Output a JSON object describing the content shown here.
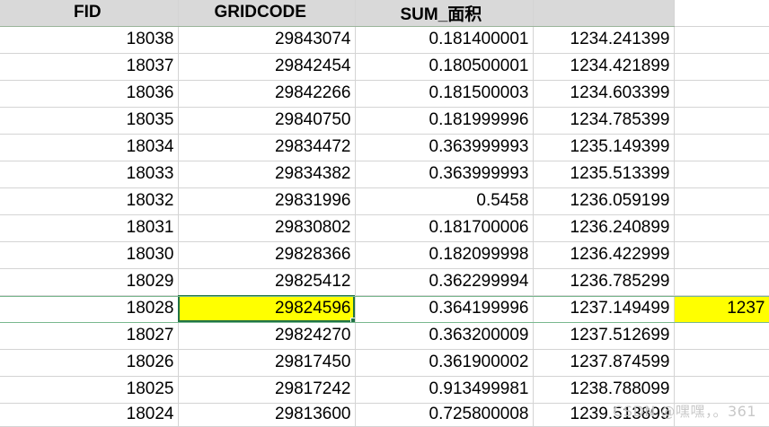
{
  "headers": [
    "FID",
    "GRIDCODE",
    "SUM_面积",
    "",
    ""
  ],
  "rows": [
    [
      "18038",
      "29843074",
      "0.181400001",
      "1234.241399",
      ""
    ],
    [
      "18037",
      "29842454",
      "0.180500001",
      "1234.421899",
      ""
    ],
    [
      "18036",
      "29842266",
      "0.181500003",
      "1234.603399",
      ""
    ],
    [
      "18035",
      "29840750",
      "0.181999996",
      "1234.785399",
      ""
    ],
    [
      "18034",
      "29834472",
      "0.363999993",
      "1235.149399",
      ""
    ],
    [
      "18033",
      "29834382",
      "0.363999993",
      "1235.513399",
      ""
    ],
    [
      "18032",
      "29831996",
      "0.5458",
      "1236.059199",
      ""
    ],
    [
      "18031",
      "29830802",
      "0.181700006",
      "1236.240899",
      ""
    ],
    [
      "18030",
      "29828366",
      "0.182099998",
      "1236.422999",
      ""
    ],
    [
      "18029",
      "29825412",
      "0.362299994",
      "1236.785299",
      ""
    ],
    [
      "18028",
      "29824596",
      "0.364199996",
      "1237.149499",
      "1237"
    ],
    [
      "18027",
      "29824270",
      "0.363200009",
      "1237.512699",
      ""
    ],
    [
      "18026",
      "29817450",
      "0.361900002",
      "1237.874599",
      ""
    ],
    [
      "18025",
      "29817242",
      "0.913499981",
      "1238.788099",
      ""
    ],
    [
      "18024",
      "29813600",
      "0.725800008",
      "1239.513899",
      ""
    ]
  ],
  "selection": {
    "row": 10,
    "col": 1
  },
  "highlight_color": "#ffff00",
  "selection_color": "#217346",
  "watermark": "CSDN @嘿嘿，。361"
}
